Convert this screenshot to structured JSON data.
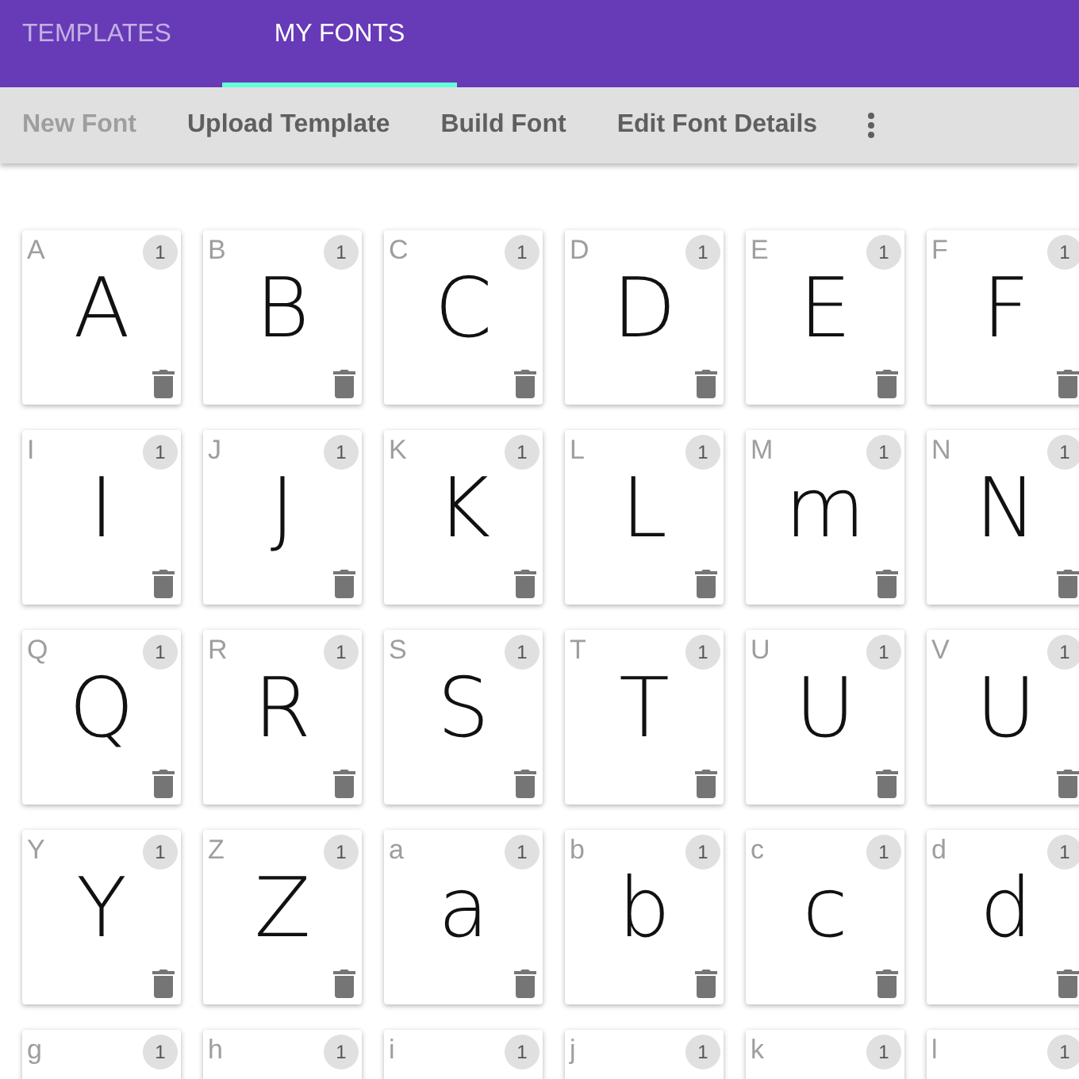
{
  "tabs": [
    {
      "label": "TEMPLATES",
      "selected": false
    },
    {
      "label": "MY FONTS",
      "selected": true
    }
  ],
  "toolbar": [
    {
      "label": "New Font",
      "disabled": true
    },
    {
      "label": "Upload Template",
      "disabled": false
    },
    {
      "label": "Build Font",
      "disabled": false
    },
    {
      "label": "Edit Font Details",
      "disabled": false
    }
  ],
  "glyphs": [
    {
      "letter": "A",
      "count": "1",
      "glyph": "A"
    },
    {
      "letter": "B",
      "count": "1",
      "glyph": "B"
    },
    {
      "letter": "C",
      "count": "1",
      "glyph": "C"
    },
    {
      "letter": "D",
      "count": "1",
      "glyph": "D"
    },
    {
      "letter": "E",
      "count": "1",
      "glyph": "E"
    },
    {
      "letter": "F",
      "count": "1",
      "glyph": "F"
    },
    {
      "letter": "I",
      "count": "1",
      "glyph": "I"
    },
    {
      "letter": "J",
      "count": "1",
      "glyph": "J"
    },
    {
      "letter": "K",
      "count": "1",
      "glyph": "K"
    },
    {
      "letter": "L",
      "count": "1",
      "glyph": "L"
    },
    {
      "letter": "M",
      "count": "1",
      "glyph": "m"
    },
    {
      "letter": "N",
      "count": "1",
      "glyph": "N"
    },
    {
      "letter": "Q",
      "count": "1",
      "glyph": "Q"
    },
    {
      "letter": "R",
      "count": "1",
      "glyph": "R"
    },
    {
      "letter": "S",
      "count": "1",
      "glyph": "S"
    },
    {
      "letter": "T",
      "count": "1",
      "glyph": "T"
    },
    {
      "letter": "U",
      "count": "1",
      "glyph": "U"
    },
    {
      "letter": "V",
      "count": "1",
      "glyph": "U"
    },
    {
      "letter": "Y",
      "count": "1",
      "glyph": "Y"
    },
    {
      "letter": "Z",
      "count": "1",
      "glyph": "Z"
    },
    {
      "letter": "a",
      "count": "1",
      "glyph": "a"
    },
    {
      "letter": "b",
      "count": "1",
      "glyph": "b"
    },
    {
      "letter": "c",
      "count": "1",
      "glyph": "c"
    },
    {
      "letter": "d",
      "count": "1",
      "glyph": "d"
    },
    {
      "letter": "g",
      "count": "1"
    },
    {
      "letter": "h",
      "count": "1"
    },
    {
      "letter": "i",
      "count": "1"
    },
    {
      "letter": "j",
      "count": "1"
    },
    {
      "letter": "k",
      "count": "1"
    },
    {
      "letter": "l",
      "count": "1"
    }
  ]
}
